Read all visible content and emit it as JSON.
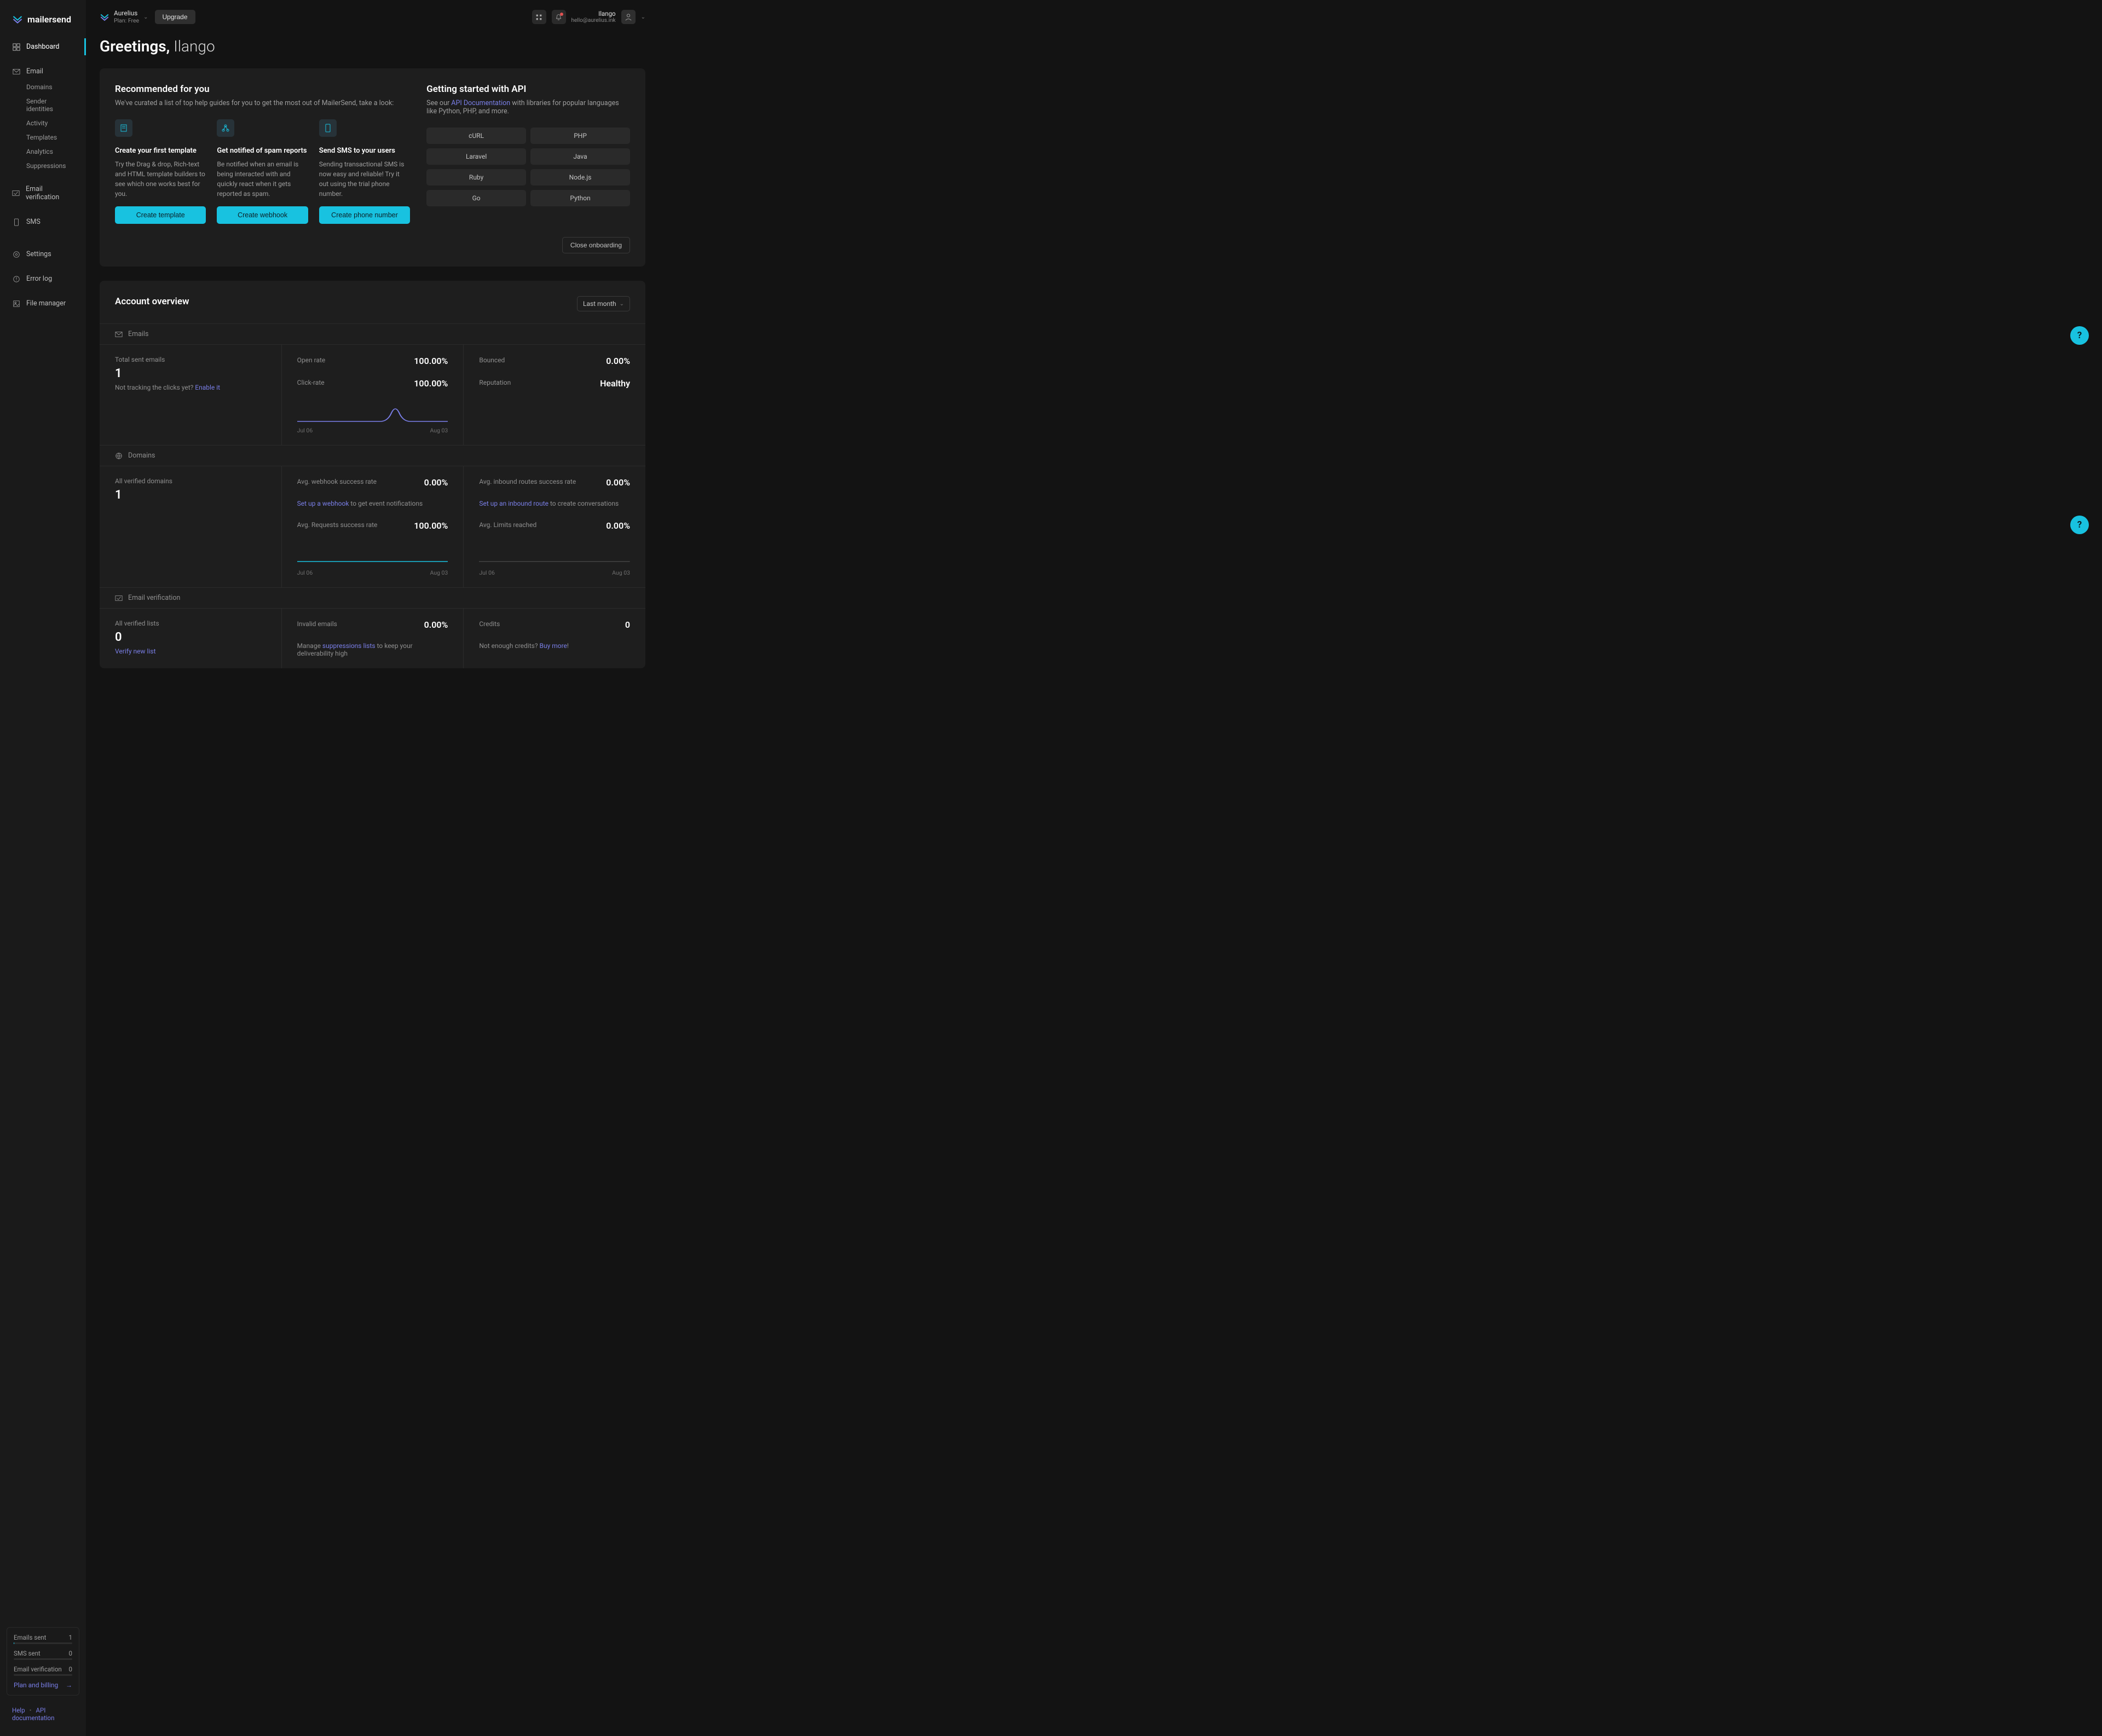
{
  "brand": "mailersend",
  "sidebar": {
    "dashboard": "Dashboard",
    "email": "Email",
    "email_sub": [
      "Domains",
      "Sender identities",
      "Activity",
      "Templates",
      "Analytics",
      "Suppressions"
    ],
    "email_verification": "Email verification",
    "sms": "SMS",
    "settings": "Settings",
    "error_log": "Error log",
    "file_manager": "File manager",
    "usage": {
      "emails_sent": {
        "label": "Emails sent",
        "value": "1"
      },
      "sms_sent": {
        "label": "SMS sent",
        "value": "0"
      },
      "email_verification": {
        "label": "Email verification",
        "value": "0"
      },
      "plan_link": "Plan and billing"
    },
    "footer": {
      "help": "Help",
      "api": "API documentation"
    }
  },
  "topbar": {
    "account_name": "Aurelius",
    "account_plan": "Plan: Free",
    "upgrade": "Upgrade",
    "user_name": "Ilango",
    "user_email": "hello@aurelius.ink"
  },
  "greeting": {
    "prefix": "Greetings,",
    "name": "Ilango"
  },
  "recommended": {
    "title": "Recommended for you",
    "subtitle": "We've curated a list of top help guides for you to get the most out of MailerSend, take a look:",
    "cards": [
      {
        "title": "Create your first template",
        "text": "Try the Drag & drop, Rich-text and HTML template builders to see which one works best for you.",
        "cta": "Create template"
      },
      {
        "title": "Get notified of spam reports",
        "text": "Be notified when an email is being interacted with and quickly react when it gets reported as spam.",
        "cta": "Create webhook"
      },
      {
        "title": "Send SMS to your users",
        "text": "Sending transactional SMS is now easy and reliable! Try it out using the trial phone number.",
        "cta": "Create phone number"
      }
    ]
  },
  "getting_started": {
    "title": "Getting started with API",
    "prefix": "See our ",
    "link": "API Documentation",
    "suffix": " with libraries for popular languages like Python, PHP, and more.",
    "langs": [
      "cURL",
      "PHP",
      "Laravel",
      "Java",
      "Ruby",
      "Node.js",
      "Go",
      "Python"
    ]
  },
  "close_onboarding": "Close onboarding",
  "overview": {
    "title": "Account overview",
    "filter": "Last month",
    "sections": {
      "emails": {
        "header": "Emails",
        "total_label": "Total sent emails",
        "total_value": "1",
        "tracking_prefix": "Not tracking the clicks yet? ",
        "tracking_link": "Enable it",
        "open_rate": {
          "label": "Open rate",
          "value": "100.00%"
        },
        "click_rate": {
          "label": "Click-rate",
          "value": "100.00%"
        },
        "bounced": {
          "label": "Bounced",
          "value": "0.00%"
        },
        "reputation": {
          "label": "Reputation",
          "value": "Healthy"
        },
        "spark": {
          "start": "Jul 06",
          "end": "Aug 03"
        }
      },
      "domains": {
        "header": "Domains",
        "verified_label": "All verified domains",
        "verified_value": "1",
        "webhook": {
          "label": "Avg. webhook success rate",
          "value": "0.00%",
          "link": "Set up a webhook",
          "suffix": " to get event notifications"
        },
        "requests": {
          "label": "Avg. Requests success rate",
          "value": "100.00%"
        },
        "inbound": {
          "label": "Avg. inbound routes success rate",
          "value": "0.00%",
          "link": "Set up an inbound route",
          "suffix": " to create conversations"
        },
        "limits": {
          "label": "Avg. Limits reached",
          "value": "0.00%"
        },
        "spark": {
          "start": "Jul 06",
          "end": "Aug 03"
        }
      },
      "ev": {
        "header": "Email verification",
        "lists_label": "All verified lists",
        "lists_value": "0",
        "verify_link": "Verify new list",
        "invalid": {
          "label": "Invalid emails",
          "value": "0.00%",
          "prefix": "Manage ",
          "link": "suppressions lists",
          "suffix": " to keep your deliverability high"
        },
        "credits": {
          "label": "Credits",
          "value": "0",
          "prefix": "Not enough credits? ",
          "link": "Buy more",
          "suffix": "!"
        }
      }
    }
  }
}
